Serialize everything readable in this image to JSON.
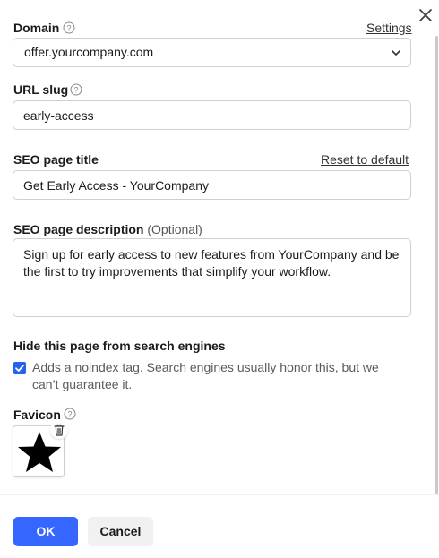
{
  "window": {
    "close_icon": "close-icon"
  },
  "domain": {
    "label": "Domain",
    "help_icon": "question-circle-icon",
    "settings_link": "Settings",
    "value": "offer.yourcompany.com",
    "dropdown_icon": "chevron-down-icon"
  },
  "url_slug": {
    "label": "URL slug",
    "help_icon": "question-circle-icon",
    "value": "early-access"
  },
  "seo_title": {
    "label": "SEO page title",
    "reset_link": "Reset to default",
    "value": "Get Early Access - YourCompany"
  },
  "seo_description": {
    "label": "SEO page description",
    "optional_label": "(Optional)",
    "value": "Sign up for early access to new features from YourCompany and be the first to try improvements that simplify your workflow."
  },
  "search_engines": {
    "label": "Hide this page from search engines",
    "checked": true,
    "checkbox_text": "Adds a noindex tag. Search engines usually honor this, but we can’t guarantee it."
  },
  "favicon": {
    "label": "Favicon",
    "help_icon": "question-circle-icon",
    "image_icon": "star-icon",
    "delete_icon": "trash-icon"
  },
  "footer": {
    "ok_label": "OK",
    "cancel_label": "Cancel"
  },
  "colors": {
    "primary": "#3566ff",
    "checkbox": "#2563eb",
    "border": "#cfcfcf"
  }
}
